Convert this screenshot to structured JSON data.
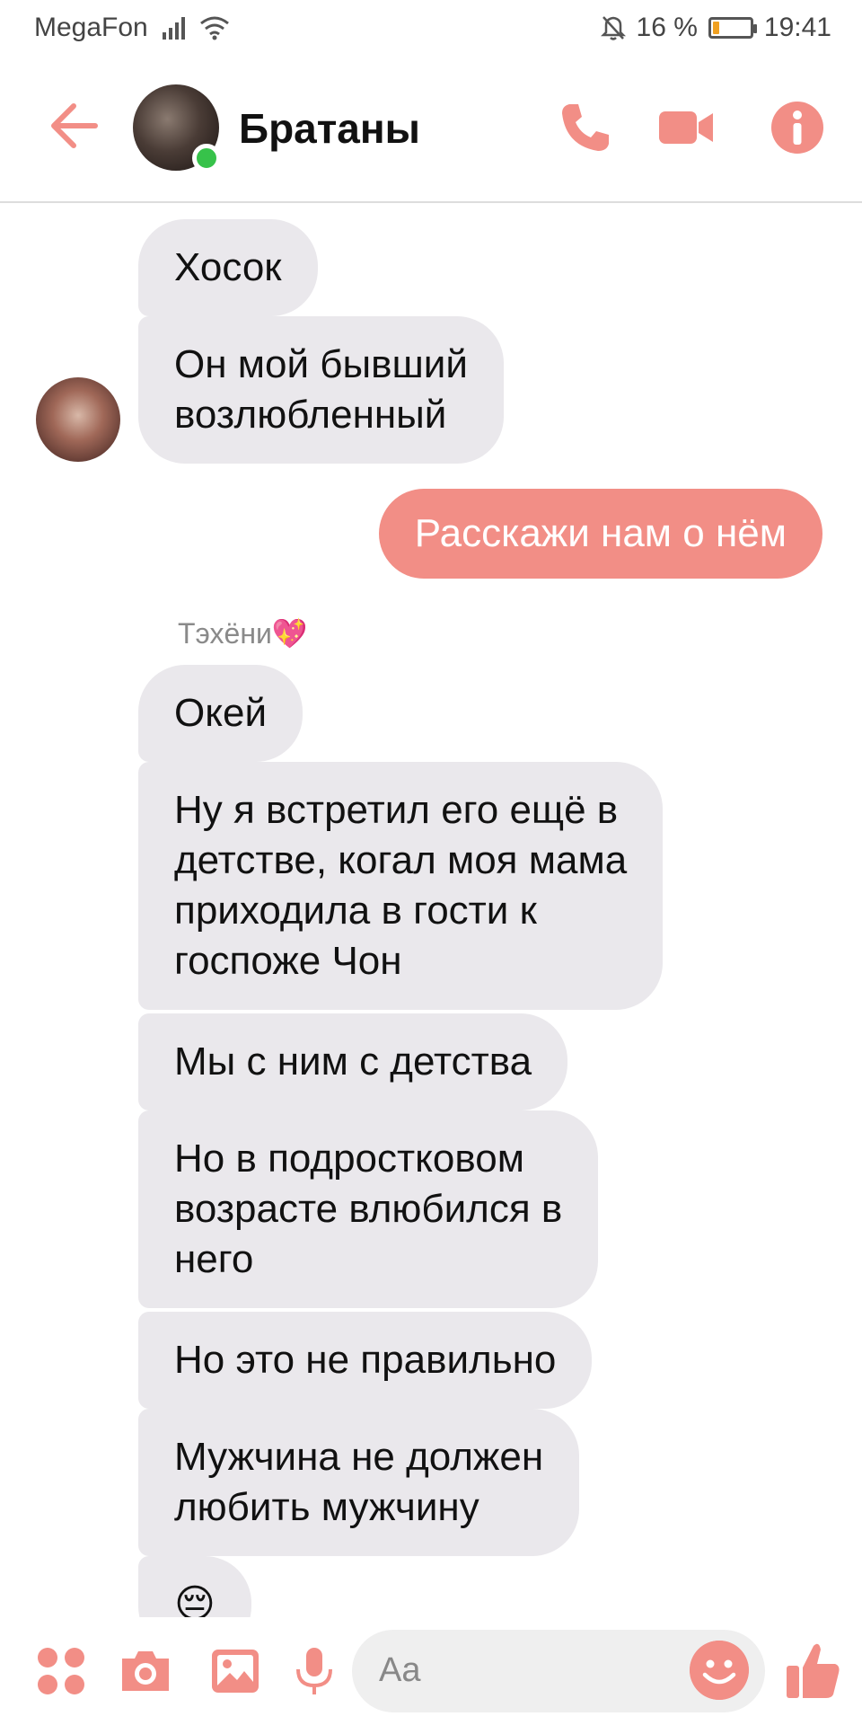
{
  "status_bar": {
    "carrier": "MegaFon",
    "battery_percent": "16 %",
    "battery_level": 0.16,
    "time": "19:41"
  },
  "header": {
    "title": "Братаны",
    "icons": [
      "back-arrow-icon",
      "phone-icon",
      "video-camera-icon",
      "info-icon"
    ]
  },
  "messages": [
    {
      "direction": "in",
      "text": "Хосок"
    },
    {
      "direction": "in",
      "text": "Он мой бывший\nвозлюбленный"
    },
    {
      "direction": "out",
      "text": "Расскажи нам о нём"
    },
    {
      "direction": "in",
      "sender": "Тэхёни💖",
      "text": "Окей"
    },
    {
      "direction": "in",
      "text": "Ну я встретил его ещё в\nдетстве, когал моя мама\nприходила в гости к\nгоспоже Чон"
    },
    {
      "direction": "in",
      "text": "Мы с ним с детства"
    },
    {
      "direction": "in",
      "text": "Но в подростковом\nвозрасте влюбился в\nнего"
    },
    {
      "direction": "in",
      "text": "Но это не правильно"
    },
    {
      "direction": "in",
      "text": "Мужчина не должен\nлюбить мужчину"
    },
    {
      "direction": "in",
      "text": "😔"
    }
  ],
  "composer": {
    "placeholder": "Aa",
    "icons": [
      "apps-grid-icon",
      "camera-icon",
      "gallery-icon",
      "microphone-icon",
      "emoji-icon",
      "thumbs-up-icon"
    ]
  },
  "colors": {
    "accent": "#f28e86",
    "incoming_bubble": "#eae8ec",
    "online": "#37c24a"
  }
}
